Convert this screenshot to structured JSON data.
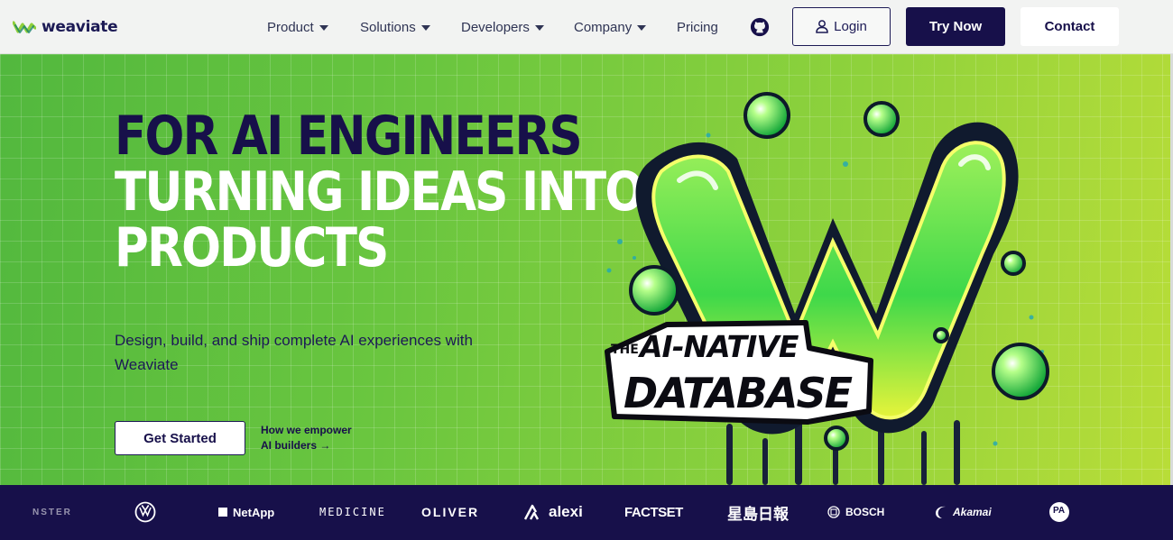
{
  "nav": {
    "logo_text": "weaviate",
    "menu": [
      {
        "label": "Product",
        "dropdown": true
      },
      {
        "label": "Solutions",
        "dropdown": true
      },
      {
        "label": "Developers",
        "dropdown": true
      },
      {
        "label": "Company",
        "dropdown": true
      },
      {
        "label": "Pricing",
        "dropdown": false
      }
    ],
    "github_icon": "github-icon",
    "login_label": "Login",
    "try_label": "Try Now",
    "contact_label": "Contact"
  },
  "hero": {
    "headline_1": "FOR AI ENGINEERS",
    "headline_2": "TURNING IDEAS INTO",
    "headline_3": "PRODUCTS",
    "subtext": "Design, build, and ship complete AI experiences with Weaviate",
    "cta_label": "Get Started",
    "link_line1": "How we empower",
    "link_line2": "AI builders →",
    "art": {
      "small_text": "THE",
      "line1": "AI-NATIVE",
      "line2": "DATABASE"
    }
  },
  "colors": {
    "navy": "#17104a",
    "green": "#6cc83e",
    "lime": "#b9dd38",
    "white": "#ffffff"
  },
  "customers": [
    {
      "name": "NSTER",
      "icon": ""
    },
    {
      "name": "",
      "icon": "volkswagen-icon"
    },
    {
      "name": "NetApp",
      "icon": "netapp-icon"
    },
    {
      "name": "MEDICINE",
      "icon": ""
    },
    {
      "name": "OLIVER",
      "icon": ""
    },
    {
      "name": "alexi",
      "icon": "alexi-icon"
    },
    {
      "name": "FACTSET",
      "icon": ""
    },
    {
      "name": "星島日報",
      "icon": ""
    },
    {
      "name": "BOSCH",
      "icon": "bosch-icon"
    },
    {
      "name": "Akamai",
      "icon": "akamai-icon"
    },
    {
      "name": "PA",
      "icon": "pa-icon"
    }
  ]
}
